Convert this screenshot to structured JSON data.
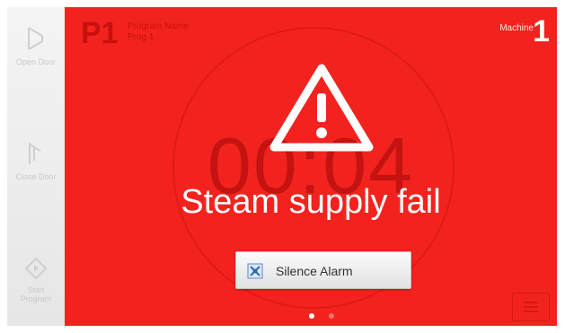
{
  "sidebar": {
    "items": [
      {
        "label": "Open Door",
        "icon": "open-door-icon"
      },
      {
        "label": "Close Door",
        "icon": "close-door-icon"
      },
      {
        "label": "Start Program",
        "icon": "start-program-icon"
      }
    ]
  },
  "program": {
    "number": "P1",
    "title_line1": "Program Name",
    "title_line2": "Prog 1"
  },
  "machine": {
    "label": "Machine",
    "number": "1"
  },
  "timer": "00:04",
  "alarm": {
    "icon": "warning-triangle-icon",
    "message": "Steam supply fail"
  },
  "silence_button": {
    "label": "Silence Alarm",
    "icon": "silence-alarm-icon"
  },
  "pager": {
    "pages": 2,
    "active": 1
  },
  "menu_button": {
    "icon": "menu-icon"
  },
  "colors": {
    "alarm_background": "#f2231e",
    "sidebar_background": "#eeeeee",
    "text_white": "#ffffff"
  }
}
